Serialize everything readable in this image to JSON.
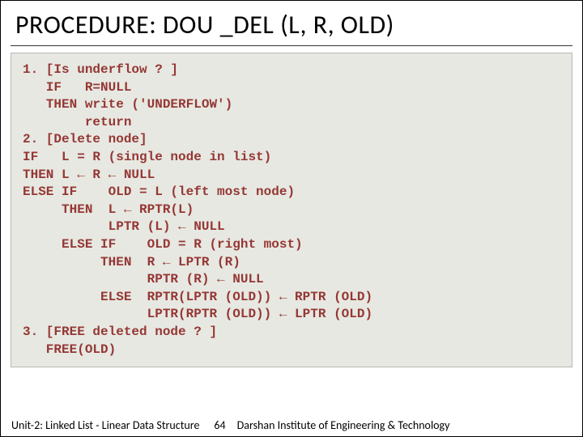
{
  "title": "PROCEDURE: DOU _DEL (L, R, OLD)",
  "code": "1. [Is underflow ? ]\n   IF   R=NULL\n   THEN write ('UNDERFLOW')\n        return\n2. [Delete node]\nIF   L = R (single node in list)\nTHEN L ← R ← NULL\nELSE IF    OLD = L (left most node)\n     THEN  L ← RPTR(L)\n           LPTR (L) ← NULL\n     ELSE IF    OLD = R (right most)\n          THEN  R ← LPTR (R)\n                RPTR (R) ← NULL\n          ELSE  RPTR(LPTR (OLD)) ← RPTR (OLD)\n                LPTR(RPTR (OLD)) ← LPTR (OLD)\n3. [FREE deleted node ? ]\n   FREE(OLD)",
  "footer": {
    "unit": "Unit-2: Linked List - Linear Data Structure",
    "page": "64",
    "institute": "Darshan Institute of Engineering & Technology"
  }
}
